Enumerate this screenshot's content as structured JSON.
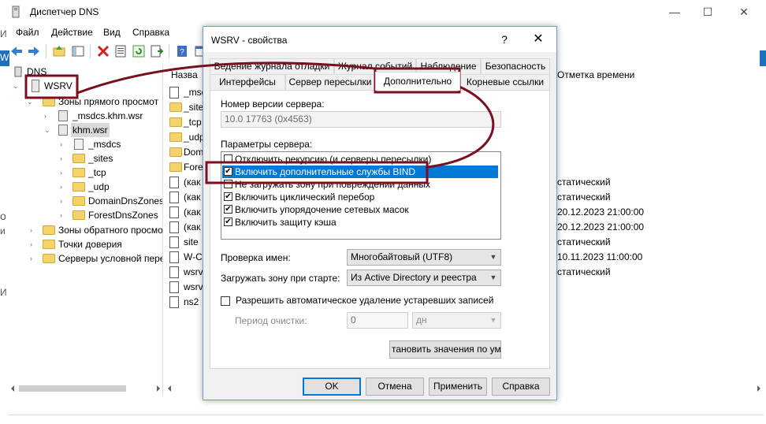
{
  "background_window": {
    "title": "Диспетчер DNS",
    "controls": [
      "—",
      "☐",
      "✕"
    ],
    "menu": [
      "Файл",
      "Действие",
      "Вид",
      "Справка"
    ],
    "left_edge_letters": [
      "И",
      "W",
      "о",
      "и",
      "И"
    ],
    "tree": {
      "root": "DNS",
      "server": "WSRV",
      "items": [
        "Зоны прямого просмот",
        "_msdcs.khm.wsr",
        "khm.wsr",
        "_msdcs",
        "_sites",
        "_tcp",
        "_udp",
        "DomainDnsZones",
        "ForestDnsZones",
        "Зоны обратного просмо",
        "Точки доверия",
        "Серверы условной пере"
      ]
    },
    "list": {
      "name_header": "Назва",
      "timestamp_header": "Отметка времени",
      "names": [
        "_msdc",
        "_sites",
        "_tcp",
        "_udp",
        "Dom",
        "Fores",
        "(как",
        "(как",
        "(как",
        "(как",
        "site",
        "W-C",
        "wsrv",
        "wsrv",
        "ns2"
      ],
      "timestamps": [
        "статический",
        "статический",
        "20.12.2023 21:00:00",
        "20.12.2023 21:00:00",
        "статический",
        "10.11.2023 11:00:00",
        "статический"
      ]
    }
  },
  "dialog": {
    "title": "WSRV - свойства",
    "help": "?",
    "close": "✕",
    "tabs_row1": [
      "Ведение журнала отладки",
      "Журнал событий",
      "Наблюдение",
      "Безопасность"
    ],
    "tabs_row2": [
      "Интерфейсы",
      "Сервер пересылки",
      "Дополнительно",
      "Корневые ссылки"
    ],
    "version_label": "Номер версии сервера:",
    "version_value": "10.0 17763 (0x4563)",
    "params_label": "Параметры сервера:",
    "options": [
      {
        "text": "Отключить рекурсию (и серверы пересылки)",
        "checked": false
      },
      {
        "text": "Включить дополнительные службы BIND",
        "checked": true
      },
      {
        "text": "Не загружать зону при повреждении данных",
        "checked": false
      },
      {
        "text": "Включить циклический перебор",
        "checked": true
      },
      {
        "text": "Включить упорядочение сетевых масок",
        "checked": true
      },
      {
        "text": "Включить защиту кэша",
        "checked": true
      }
    ],
    "name_check_label": "Проверка имен:",
    "name_check_value": "Многобайтовый (UTF8)",
    "load_zone_label": "Загружать зону при старте:",
    "load_zone_value": "Из Active Directory и реестра",
    "scavenge_label": "Разрешить автоматическое удаление устаревших записей",
    "period_label": "Период очистки:",
    "period_value": "0",
    "period_unit": "дн",
    "defaults_button": "тановить значения по умолч",
    "buttons": {
      "ok": "OK",
      "cancel": "Отмена",
      "apply": "Применить",
      "help": "Справка"
    }
  },
  "colors": {
    "annotation": "#7a0f1f",
    "selection": "#0078d7",
    "accent_blue": "#1e6fbd"
  }
}
